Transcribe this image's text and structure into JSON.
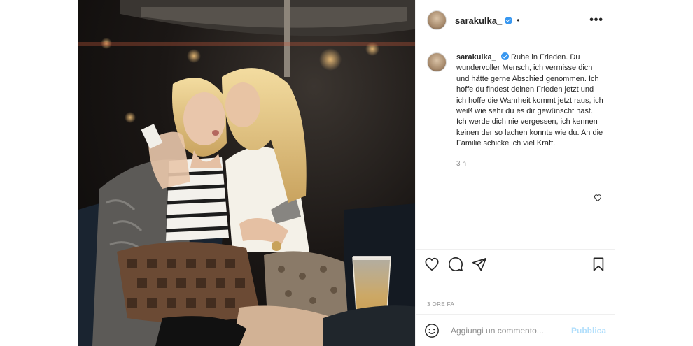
{
  "post": {
    "username": "sarakulka_",
    "verified": true,
    "more_icon": "more-horizontal-icon",
    "caption_username": "sarakulka_",
    "caption_text": "Ruhe in Frieden. Du wundervoller Mensch, ich vermisse dich und hätte gerne Abschied genommen. Ich hoffe du findest deinen Frieden jetzt und ich hoffe die Wahrheit kommt jetzt raus, ich weiß wie sehr du es dir gewünscht hast. Ich werde dich nie vergessen, ich kennen keinen der so lachen konnte wie du. An die Familie schicke ich viel Kraft.",
    "caption_time": "3 h",
    "posted_time": "3 ORE FA",
    "add_comment_placeholder": "Aggiungi un commento...",
    "publish_label": "Pubblica"
  },
  "icons": {
    "like": "heart-icon",
    "comment": "comment-icon",
    "share": "paper-plane-icon",
    "save": "bookmark-icon",
    "emoji": "smiley-icon"
  },
  "colors": {
    "verified": "#3897f0",
    "publish_disabled": "#b2dffc",
    "muted_text": "#8e8e8e",
    "border": "#efefef"
  }
}
